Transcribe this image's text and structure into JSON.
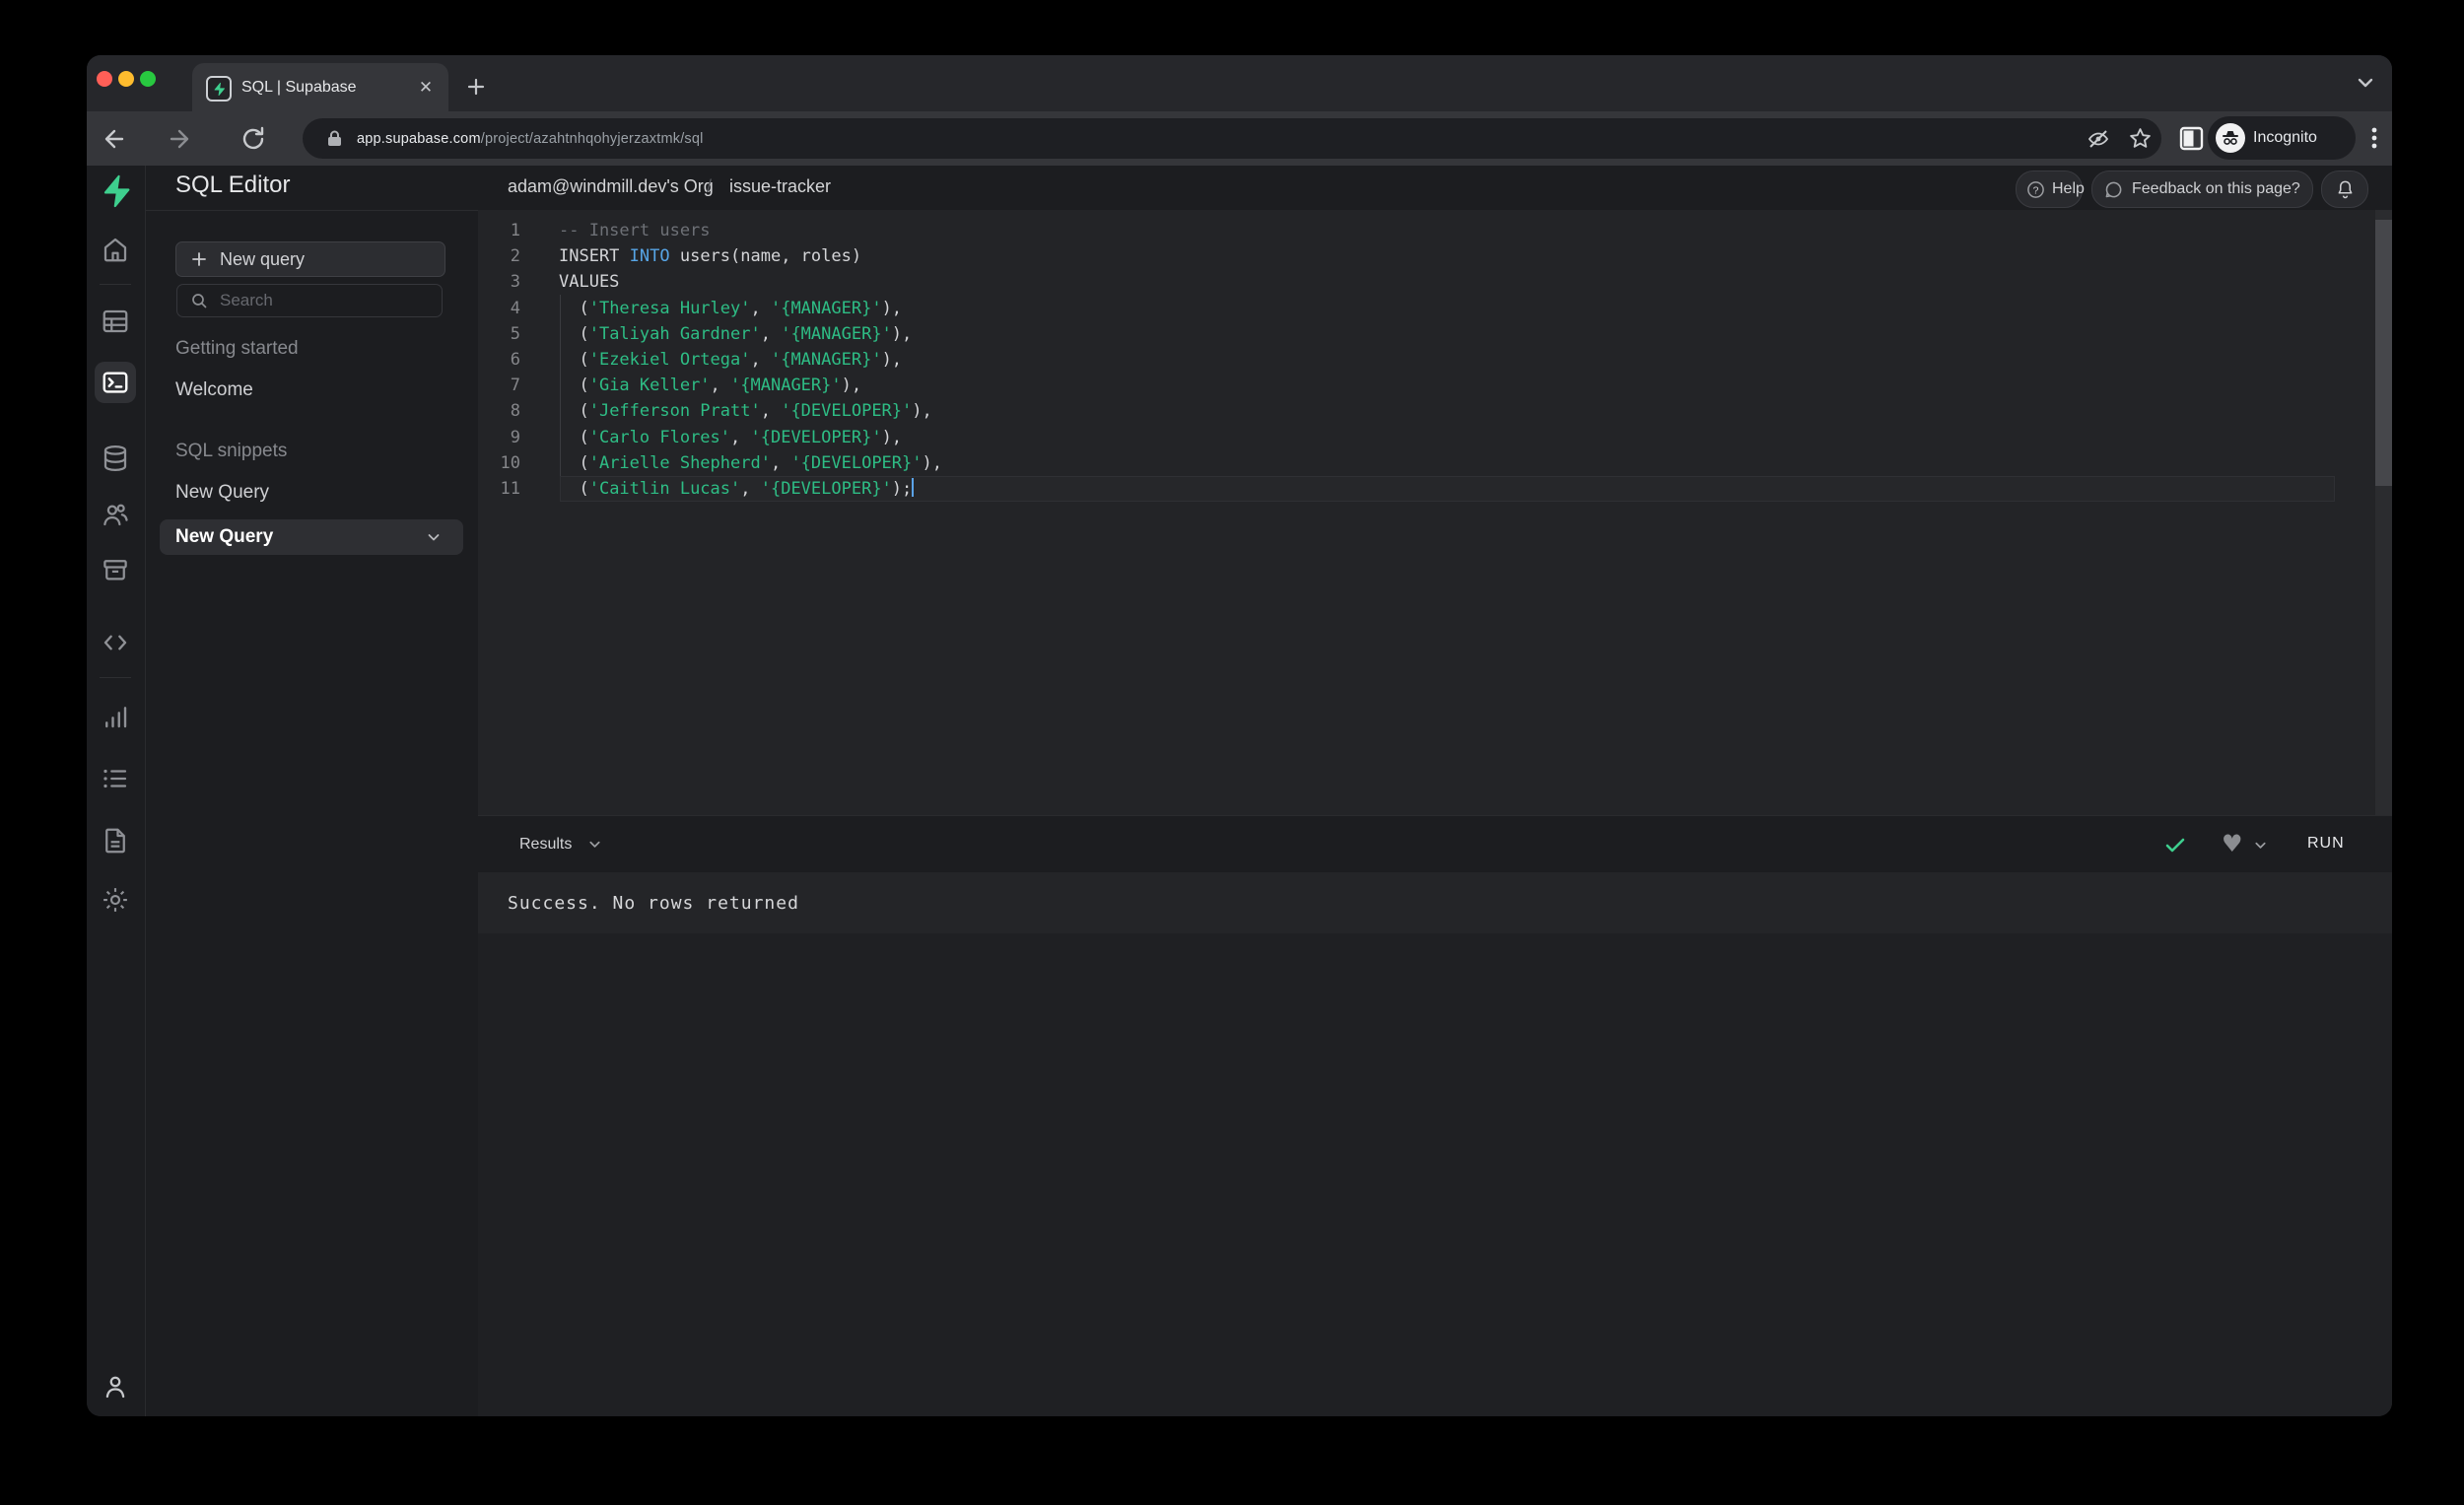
{
  "browser": {
    "tab_title": "SQL | Supabase",
    "url": {
      "host": "app.supabase.com",
      "path": "/project/azahtnhqohyjerzaxtmk/sql"
    },
    "incognito_label": "Incognito"
  },
  "rail": {
    "icons": [
      "supabase-logo",
      "home",
      "table-editor",
      "sql-editor",
      "database",
      "authentication",
      "storage",
      "edge-functions",
      "reports",
      "logs",
      "api-docs",
      "settings",
      "account"
    ],
    "active": "sql-editor"
  },
  "panel": {
    "title": "SQL Editor",
    "new_query_button": "New query",
    "search_placeholder": "Search",
    "sections": [
      {
        "header": "Getting started",
        "items": [
          {
            "label": "Welcome",
            "active": false
          }
        ]
      },
      {
        "header": "SQL snippets",
        "items": [
          {
            "label": "New Query",
            "active": false
          },
          {
            "label": "New Query",
            "active": true
          }
        ]
      }
    ]
  },
  "header": {
    "org": "adam@windmill.dev's Org",
    "separator": "/",
    "project": "issue-tracker",
    "help": "Help",
    "feedback": "Feedback on this page?"
  },
  "editor": {
    "cursor_line": 11,
    "lines": [
      {
        "no": 1,
        "segments": [
          {
            "t": "-- Insert users",
            "c": "cm"
          }
        ]
      },
      {
        "no": 2,
        "segments": [
          {
            "t": "INSERT ",
            "c": "tx"
          },
          {
            "t": "INTO",
            "c": "kw"
          },
          {
            "t": " users(name, roles)",
            "c": "tx"
          }
        ]
      },
      {
        "no": 3,
        "segments": [
          {
            "t": "VALUES",
            "c": "tx"
          }
        ]
      },
      {
        "no": 4,
        "segments": [
          {
            "t": "  (",
            "c": "tx"
          },
          {
            "t": "'Theresa Hurley'",
            "c": "str"
          },
          {
            "t": ", ",
            "c": "tx"
          },
          {
            "t": "'{MANAGER}'",
            "c": "str"
          },
          {
            "t": "),",
            "c": "tx"
          }
        ]
      },
      {
        "no": 5,
        "segments": [
          {
            "t": "  (",
            "c": "tx"
          },
          {
            "t": "'Taliyah Gardner'",
            "c": "str"
          },
          {
            "t": ", ",
            "c": "tx"
          },
          {
            "t": "'{MANAGER}'",
            "c": "str"
          },
          {
            "t": "),",
            "c": "tx"
          }
        ]
      },
      {
        "no": 6,
        "segments": [
          {
            "t": "  (",
            "c": "tx"
          },
          {
            "t": "'Ezekiel Ortega'",
            "c": "str"
          },
          {
            "t": ", ",
            "c": "tx"
          },
          {
            "t": "'{MANAGER}'",
            "c": "str"
          },
          {
            "t": "),",
            "c": "tx"
          }
        ]
      },
      {
        "no": 7,
        "segments": [
          {
            "t": "  (",
            "c": "tx"
          },
          {
            "t": "'Gia Keller'",
            "c": "str"
          },
          {
            "t": ", ",
            "c": "tx"
          },
          {
            "t": "'{MANAGER}'",
            "c": "str"
          },
          {
            "t": "),",
            "c": "tx"
          }
        ]
      },
      {
        "no": 8,
        "segments": [
          {
            "t": "  (",
            "c": "tx"
          },
          {
            "t": "'Jefferson Pratt'",
            "c": "str"
          },
          {
            "t": ", ",
            "c": "tx"
          },
          {
            "t": "'{DEVELOPER}'",
            "c": "str"
          },
          {
            "t": "),",
            "c": "tx"
          }
        ]
      },
      {
        "no": 9,
        "segments": [
          {
            "t": "  (",
            "c": "tx"
          },
          {
            "t": "'Carlo Flores'",
            "c": "str"
          },
          {
            "t": ", ",
            "c": "tx"
          },
          {
            "t": "'{DEVELOPER}'",
            "c": "str"
          },
          {
            "t": "),",
            "c": "tx"
          }
        ]
      },
      {
        "no": 10,
        "segments": [
          {
            "t": "  (",
            "c": "tx"
          },
          {
            "t": "'Arielle Shepherd'",
            "c": "str"
          },
          {
            "t": ", ",
            "c": "tx"
          },
          {
            "t": "'{DEVELOPER}'",
            "c": "str"
          },
          {
            "t": "),",
            "c": "tx"
          }
        ]
      },
      {
        "no": 11,
        "segments": [
          {
            "t": "  (",
            "c": "tx"
          },
          {
            "t": "'Caitlin Lucas'",
            "c": "str"
          },
          {
            "t": ", ",
            "c": "tx"
          },
          {
            "t": "'{DEVELOPER}'",
            "c": "str"
          },
          {
            "t": ");",
            "c": "tx"
          }
        ]
      }
    ]
  },
  "results": {
    "label": "Results",
    "run": "RUN",
    "message": "Success. No rows returned"
  },
  "colors": {
    "accent_green": "#3ecf8e",
    "string_green": "#2ebd85",
    "keyword_blue": "#57a5e6",
    "comment_gray": "#6d7076",
    "traffic": [
      "#ff5f57",
      "#febc2e",
      "#28c840"
    ]
  }
}
